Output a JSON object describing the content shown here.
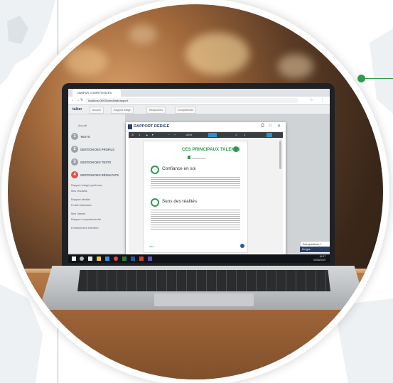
{
  "browser": {
    "tab_title": "CAMPUS COMPETENCES",
    "url": "localhost:3000/candidat/rapport"
  },
  "app": {
    "logo": "talker",
    "tabs": [
      "Accueil",
      "Rapport rédigé",
      "Ressources",
      "Compétences"
    ]
  },
  "sidebar": {
    "items": [
      "Accueil",
      "Rapport rédigé (synthèse)",
      "Mes résultats",
      "Rapport détaillé",
      "Profils Motivation",
      "Mes Talents",
      "Rapport comportemental",
      "Entraînement entretien"
    ],
    "sections": [
      {
        "num": "1",
        "label": "TESTS"
      },
      {
        "num": "2",
        "label": "GESTION DES PROFILS"
      },
      {
        "num": "3",
        "label": "GESTION DES TESTS"
      },
      {
        "num": "4",
        "label": "GESTION DES RÉSULTATS"
      }
    ]
  },
  "report": {
    "title": "RAPPORT RÉDIGÉ",
    "zoom": "100%",
    "page_heading": "CES PRINCIPAUX TALENTS",
    "section1": "Confiance en soi",
    "section2": "Sens des réalités",
    "footer_logo": "talker"
  },
  "chat": {
    "question": "Des questions ?",
    "online": "En ligne"
  },
  "taskbar": {
    "time": "16:37",
    "date": "05/06/2019"
  },
  "colors": {
    "accent_green": "#2e9b4f",
    "navy": "#2c3e63",
    "step_red": "#e05246"
  }
}
